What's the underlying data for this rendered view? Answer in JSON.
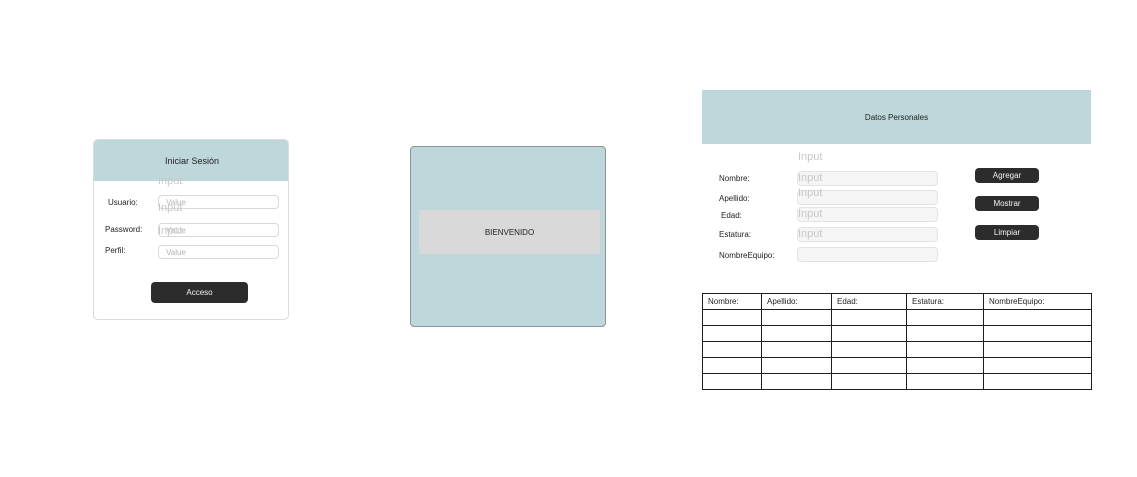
{
  "login": {
    "title": "Iniciar Sesión",
    "ghost_label": "Input",
    "fields": [
      {
        "label": "Usuario:",
        "placeholder": "Value"
      },
      {
        "label": "Password:",
        "placeholder": "Value"
      },
      {
        "label": "Perfil:",
        "placeholder": "Value"
      }
    ],
    "submit_label": "Acceso"
  },
  "welcome": {
    "text": "BIENVENIDO"
  },
  "personal": {
    "title": "Datos Personales",
    "ghost_label": "Input",
    "fields": [
      {
        "label": "Nombre:"
      },
      {
        "label": "Apellido:"
      },
      {
        "label": "Edad:"
      },
      {
        "label": "Estatura:"
      },
      {
        "label": "NombreEquipo:"
      }
    ],
    "buttons": {
      "add": "Agregar",
      "show": "Mostrar",
      "clear": "Limpiar"
    }
  },
  "table": {
    "columns": [
      "Nombre:",
      "Apellido:",
      "Edad:",
      "Estatura:",
      "NombreEquipo:"
    ],
    "rows": [
      [
        "",
        "",
        "",
        "",
        ""
      ],
      [
        "",
        "",
        "",
        "",
        ""
      ],
      [
        "",
        "",
        "",
        "",
        ""
      ],
      [
        "",
        "",
        "",
        "",
        ""
      ],
      [
        "",
        "",
        "",
        "",
        ""
      ]
    ]
  }
}
